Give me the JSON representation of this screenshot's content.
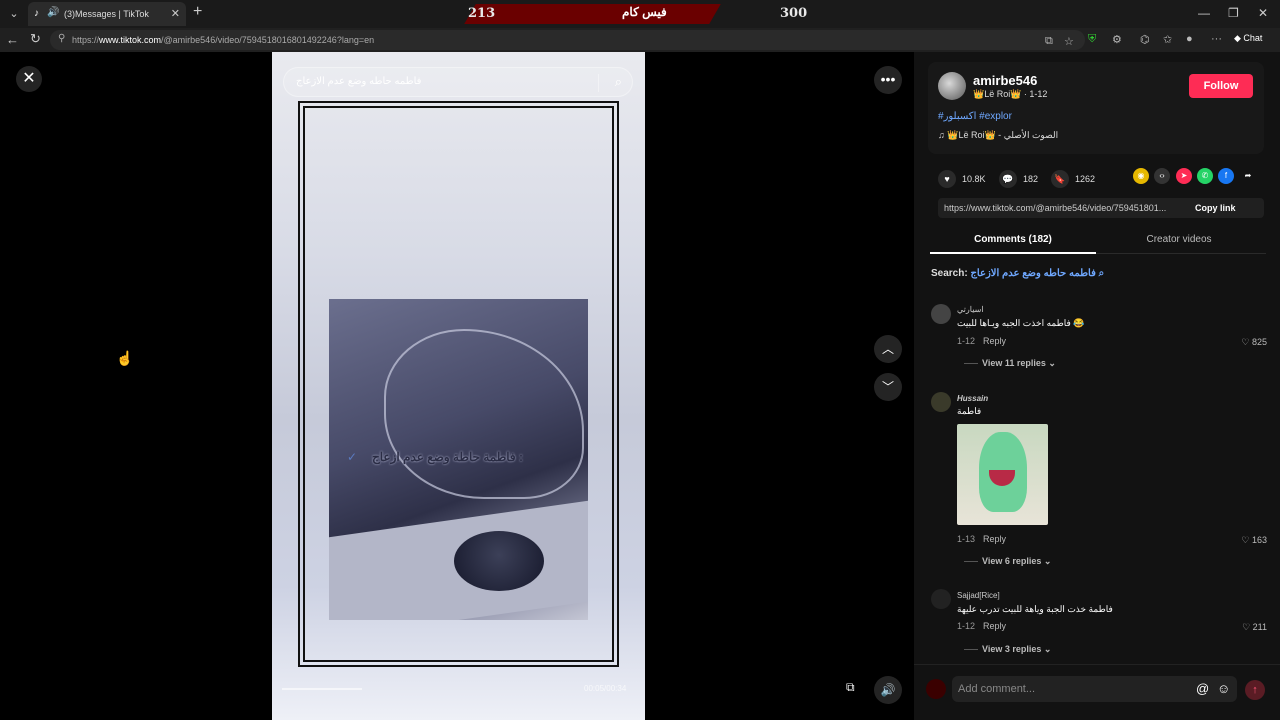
{
  "browser": {
    "tab_title": "(3)Messages | TikTok",
    "url_prefix": "https://",
    "url_domain": "www.tiktok.com",
    "url_path": "/@amirbe546/video/7594518016801492246?lang=en",
    "chat_label": "Chat"
  },
  "score_banner": {
    "left_score": "213",
    "name": "فيس كام",
    "right_score": "300",
    "color": "#6a0000"
  },
  "video": {
    "search_query": "فاطمه حاطه وضع عدم الازعاج",
    "overlay_text": "فاطمة حاطة وضع عدم ازعاج :",
    "time_text": "00:05/00:34"
  },
  "post": {
    "username": "amirbe546",
    "subline": "👑Lë Roi👑 · 1-12",
    "follow_label": "Follow",
    "hashtags": "#اكسبلور #explor",
    "music": "♫ 👑Lë Roi👑 - الصوت الأصلي",
    "likes": "10.8K",
    "comments": "182",
    "saves": "1262",
    "link": "https://www.tiktok.com/@amirbe546/video/759451801...",
    "copy_label": "Copy link",
    "accent": "#fe2c55"
  },
  "tabs": {
    "comments": "Comments (182)",
    "creator": "Creator videos"
  },
  "search_line": {
    "label": "Search:",
    "query": "فاطمه حاطه وضع عدم الازعاج"
  },
  "comments": [
    {
      "name": "اسيارتي",
      "text": "فاطمه اخذت الجبه ويـاها للبيت 😂",
      "date": "1-12",
      "reply": "Reply",
      "likes": "825",
      "view_replies": "View 11 replies"
    },
    {
      "name": "Hussain",
      "text": "فاطمة",
      "date": "1-13",
      "reply": "Reply",
      "likes": "163",
      "view_replies": "View 6 replies"
    },
    {
      "name": "Sajjad[Rice]",
      "text": "فاطمة خذت الجبة وياهة للبيت تدرب عليهة",
      "date": "1-12",
      "reply": "Reply",
      "likes": "211",
      "view_replies": "View 3 replies"
    }
  ],
  "add_comment": {
    "placeholder": "Add comment..."
  }
}
